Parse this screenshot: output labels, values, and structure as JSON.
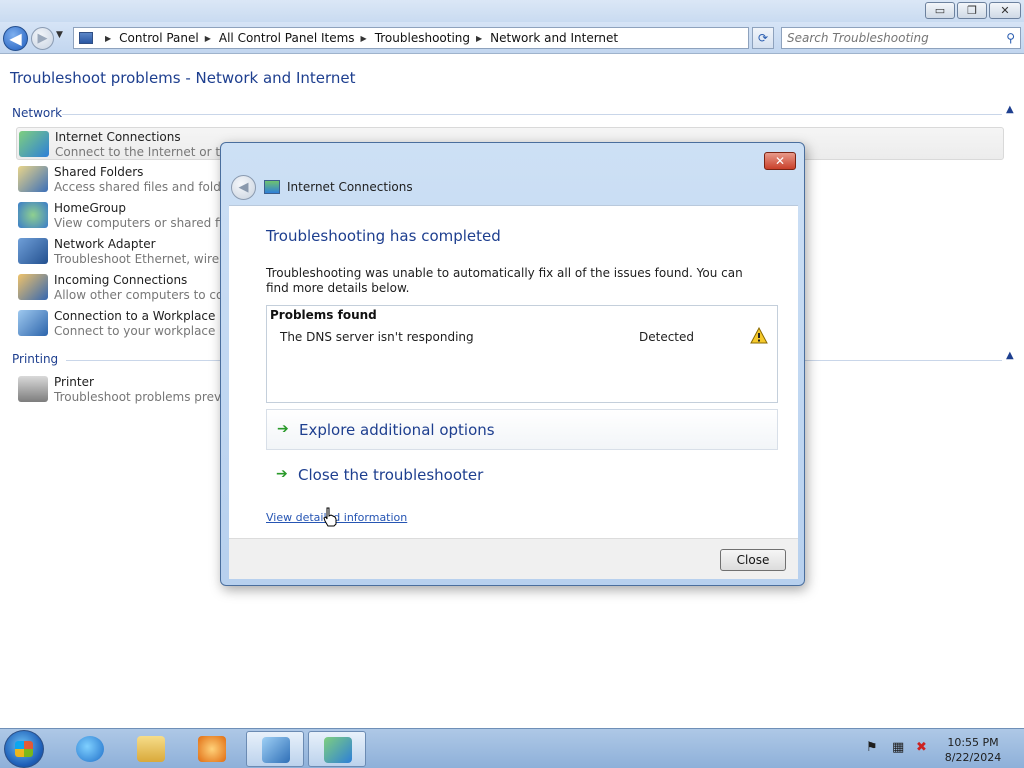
{
  "window": {
    "min_glyph": "▭",
    "max_glyph": "❐",
    "close_glyph": "✕"
  },
  "address_bar": {
    "breadcrumbs": [
      "Control Panel",
      "All Control Panel Items",
      "Troubleshooting",
      "Network and Internet"
    ],
    "search_placeholder": "Search Troubleshooting"
  },
  "page": {
    "title": "Troubleshoot problems - Network and Internet",
    "groups": [
      {
        "heading": "Network",
        "items": [
          {
            "name": "Internet Connections",
            "desc": "Connect to the Internet or to a",
            "icon": "internet-connections-icon"
          },
          {
            "name": "Shared Folders",
            "desc": "Access shared files and folders o",
            "icon": "shared-folders-icon"
          },
          {
            "name": "HomeGroup",
            "desc": "View computers or shared files i",
            "icon": "homegroup-icon"
          },
          {
            "name": "Network Adapter",
            "desc": "Troubleshoot Ethernet, wireless,",
            "icon": "network-adapter-icon"
          },
          {
            "name": "Incoming Connections",
            "desc": "Allow other computers to comm",
            "icon": "incoming-connections-icon"
          },
          {
            "name": "Connection to a Workplace Usin",
            "desc": "Connect to your workplace netw",
            "icon": "workplace-connection-icon"
          }
        ]
      },
      {
        "heading": "Printing",
        "items": [
          {
            "name": "Printer",
            "desc": "Troubleshoot problems prevent",
            "icon": "printer-icon"
          }
        ]
      }
    ]
  },
  "dialog": {
    "title": "Internet Connections",
    "heading": "Troubleshooting has completed",
    "message": "Troubleshooting was unable to automatically fix all of the issues found. You can find more details below.",
    "problems_header": "Problems found",
    "problems": [
      {
        "name": "The DNS server isn't responding",
        "status": "Detected",
        "icon": "warning-icon"
      }
    ],
    "options": [
      "Explore additional options",
      "Close the troubleshooter"
    ],
    "detail_link": "View detailed information",
    "close_button": "Close"
  },
  "taskbar": {
    "pinned": [
      "internet-explorer-icon",
      "windows-explorer-icon",
      "media-player-icon",
      "control-panel-icon",
      "troubleshooter-icon"
    ],
    "tray": {
      "time": "10:55 PM",
      "date": "8/22/2024"
    }
  }
}
